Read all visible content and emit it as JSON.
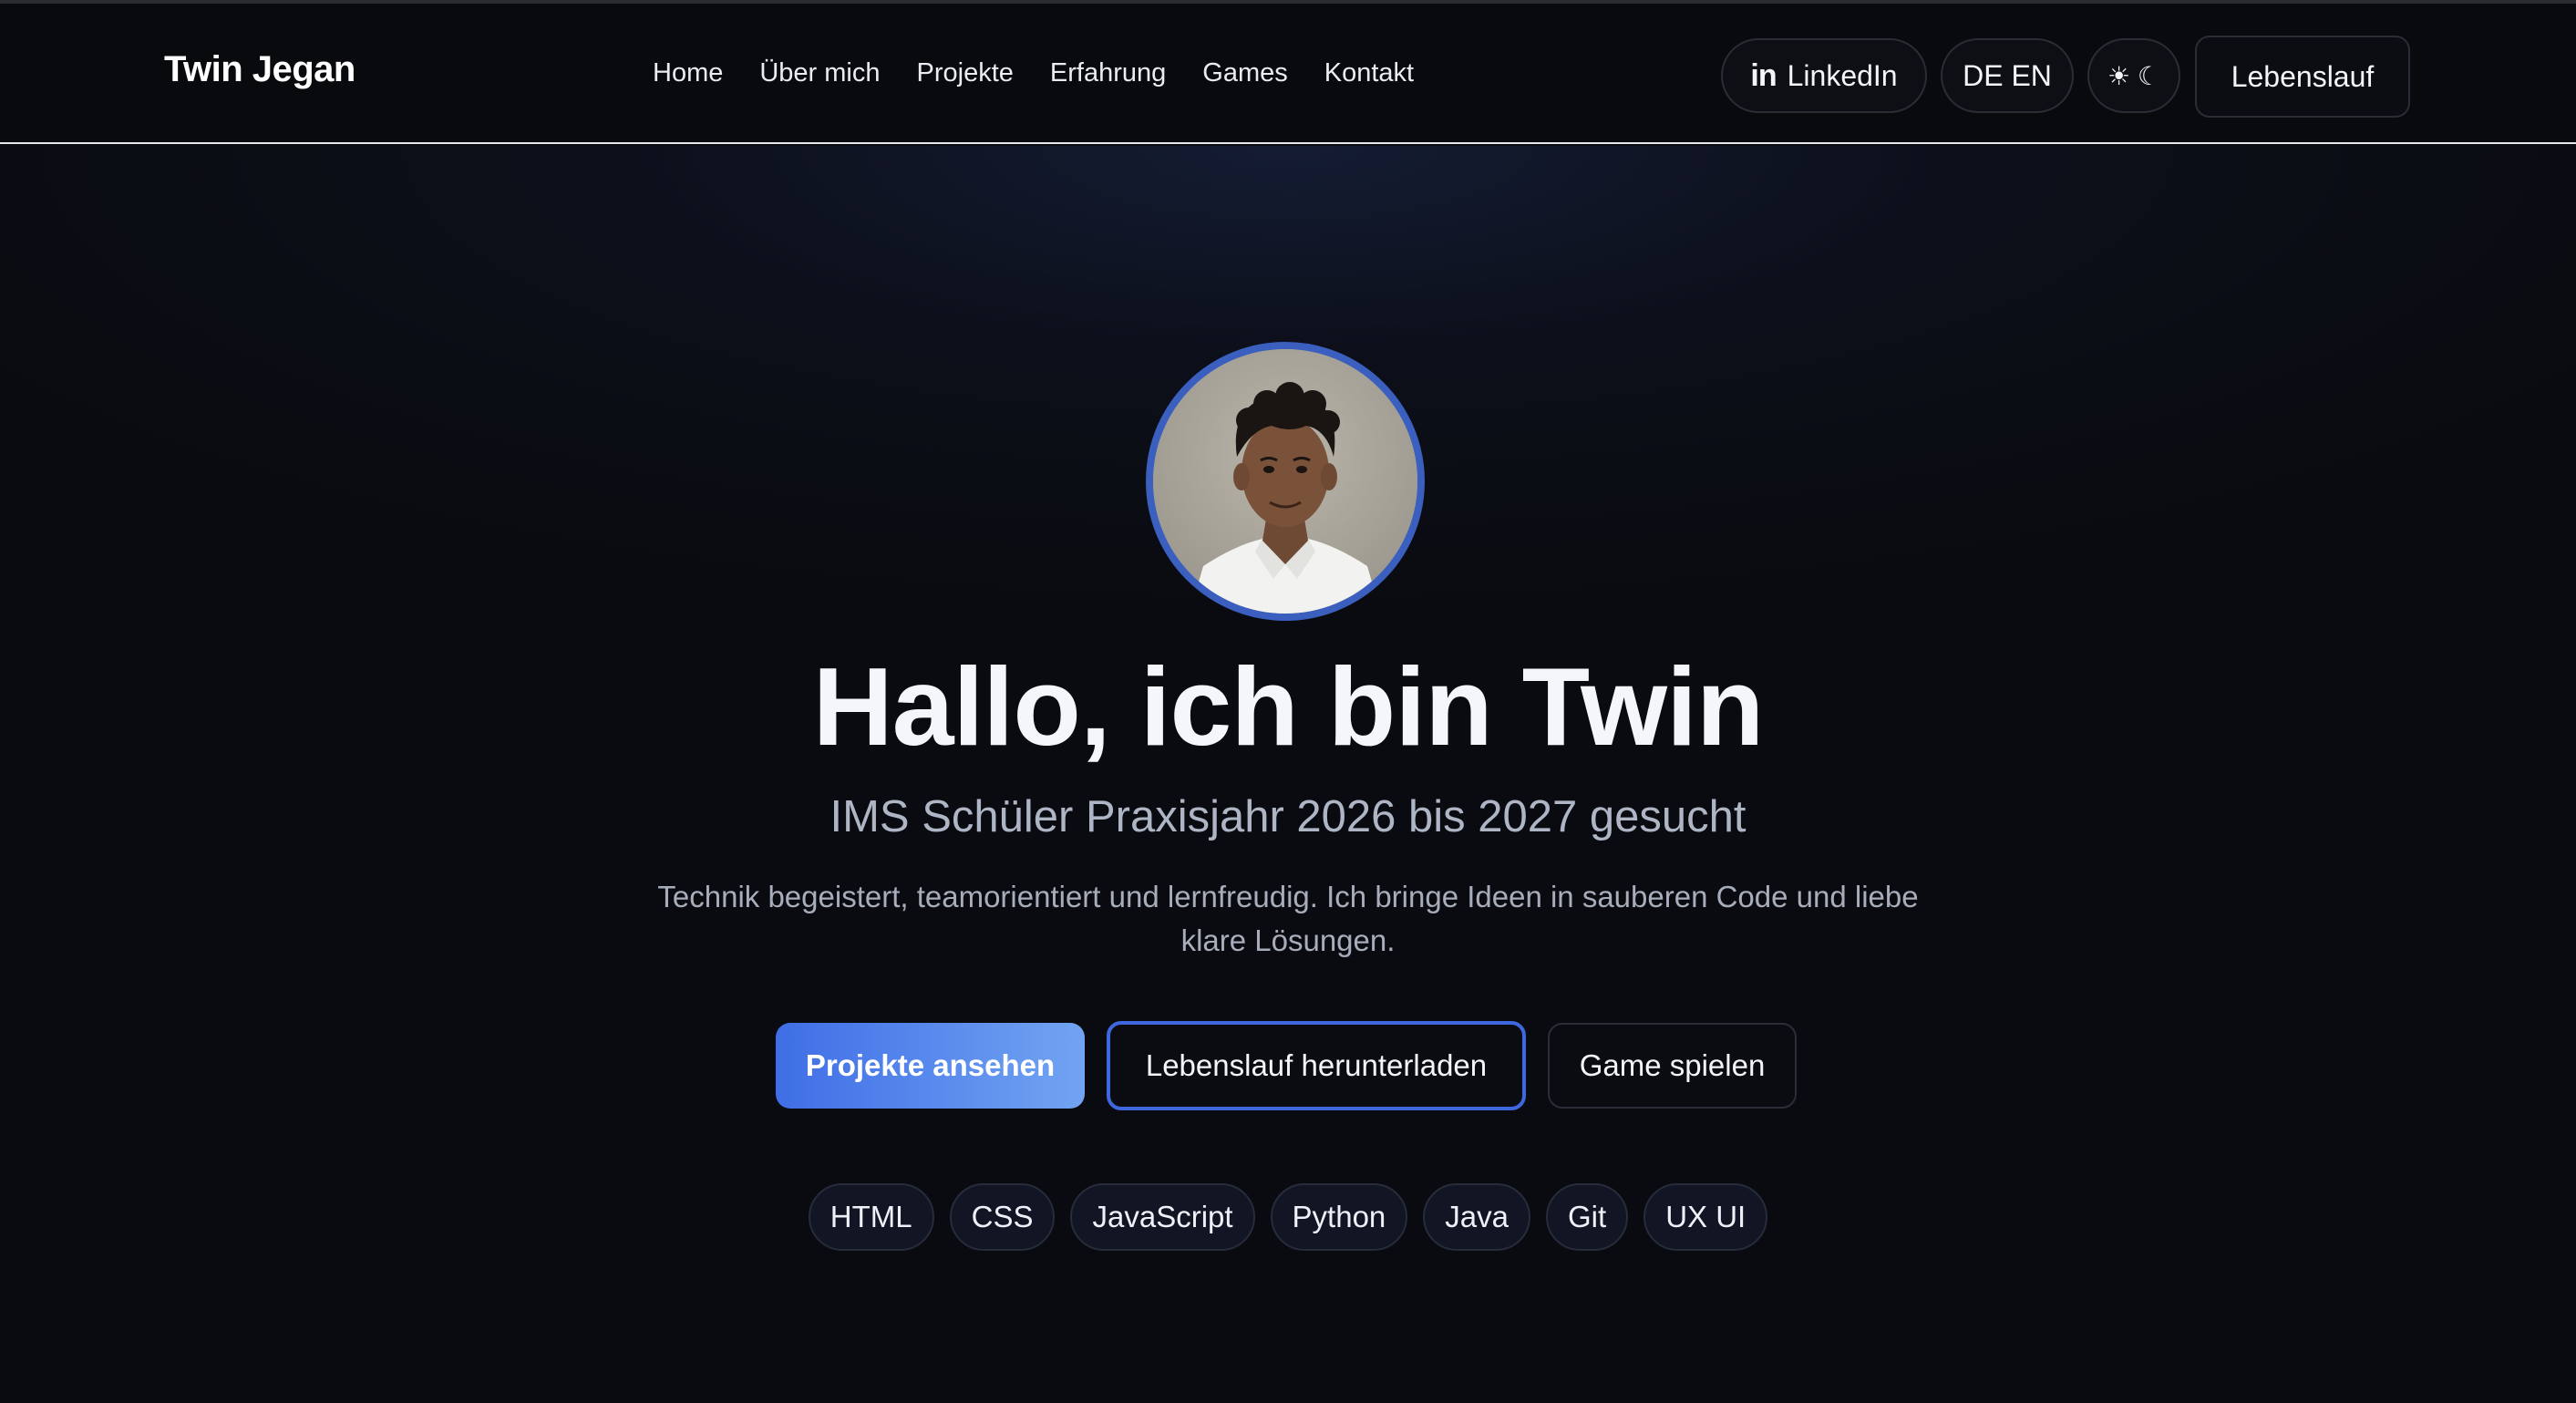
{
  "header": {
    "brand": "Twin Jegan",
    "nav": [
      "Home",
      "Über mich",
      "Projekte",
      "Erfahrung",
      "Games",
      "Kontakt"
    ],
    "linkedin_label": "LinkedIn",
    "language_label": "DE EN",
    "theme_toggle_label": "☀ ☾",
    "cv_label": "Lebenslauf"
  },
  "hero": {
    "title": "Hallo, ich bin Twin",
    "subtitle": "IMS Schüler Praxisjahr 2026 bis 2027 gesucht",
    "description": "Technik begeistert, teamorientiert und lernfreudig. Ich bringe Ideen in sauberen Code und liebe klare Lösungen.",
    "buttons": {
      "projects": "Projekte ansehen",
      "download_cv": "Lebenslauf herunterladen",
      "play_game": "Game spielen"
    },
    "skills": [
      "HTML",
      "CSS",
      "JavaScript",
      "Python",
      "Java",
      "Git",
      "UX UI"
    ]
  },
  "colors": {
    "background": "#0a0b10",
    "accent": "#3f6ee6",
    "accent_light": "#72a4f2",
    "avatar_ring": "#3b5fbf"
  }
}
